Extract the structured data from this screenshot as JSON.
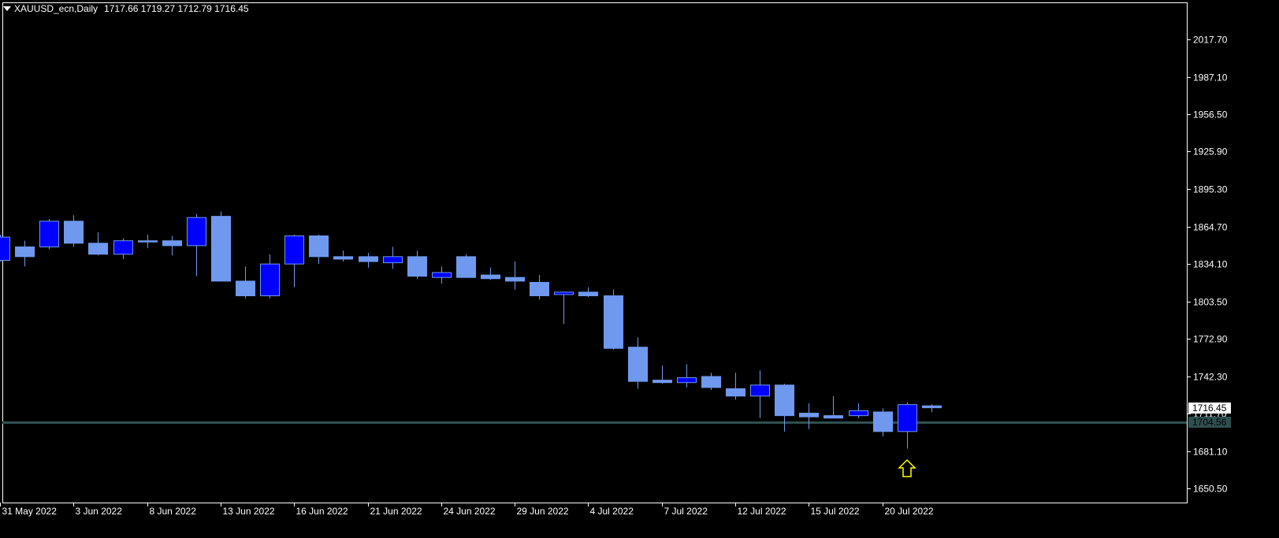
{
  "header": {
    "symbol": "XAUUSD_ecn,Daily",
    "ohlc": "1717.66 1719.27 1712.79 1716.45"
  },
  "colors": {
    "background": "#000000",
    "frame": "#ffffff",
    "bull_body": "#6f99ef",
    "bear_body": "#0000ff",
    "wick": "#6f99ef",
    "hline": "#2f4f4f",
    "arrow": "#ffff00",
    "text": "#ffffff"
  },
  "chart_data": {
    "type": "candlestick",
    "symbol": "XAUUSD_ecn",
    "timeframe": "Daily",
    "ylim": [
      1636,
      2036
    ],
    "y_ticks": [
      "2017.70",
      "1987.10",
      "1956.50",
      "1925.90",
      "1895.30",
      "1864.70",
      "1834.10",
      "1803.50",
      "1772.90",
      "1742.30",
      "1711.70",
      "1681.10",
      "1650.50"
    ],
    "x_ticks": [
      "31 May 2022",
      "3 Jun 2022",
      "8 Jun 2022",
      "13 Jun 2022",
      "16 Jun 2022",
      "21 Jun 2022",
      "24 Jun 2022",
      "29 Jun 2022",
      "4 Jul 2022",
      "7 Jul 2022",
      "12 Jul 2022",
      "15 Jul 2022",
      "20 Jul 2022"
    ],
    "current_price": "1716.45",
    "hline_price": "1704.56",
    "candles": [
      {
        "o": 1837.0,
        "h": 1858.0,
        "l": 1836.0,
        "c": 1856.0
      },
      {
        "o": 1848.0,
        "h": 1853.0,
        "l": 1832.0,
        "c": 1840.0
      },
      {
        "o": 1848.0,
        "h": 1871.0,
        "l": 1846.0,
        "c": 1869.0
      },
      {
        "o": 1869.0,
        "h": 1874.0,
        "l": 1848.0,
        "c": 1851.0
      },
      {
        "o": 1851.0,
        "h": 1860.0,
        "l": 1841.0,
        "c": 1842.0
      },
      {
        "o": 1842.0,
        "h": 1855.0,
        "l": 1838.0,
        "c": 1853.0
      },
      {
        "o": 1853.0,
        "h": 1858.0,
        "l": 1847.0,
        "c": 1852.0
      },
      {
        "o": 1853.0,
        "h": 1857.0,
        "l": 1841.0,
        "c": 1849.0
      },
      {
        "o": 1849.0,
        "h": 1875.0,
        "l": 1824.0,
        "c": 1872.0
      },
      {
        "o": 1873.0,
        "h": 1877.0,
        "l": 1820.0,
        "c": 1820.0
      },
      {
        "o": 1820.0,
        "h": 1832.0,
        "l": 1806.0,
        "c": 1808.0
      },
      {
        "o": 1808.0,
        "h": 1842.0,
        "l": 1806.0,
        "c": 1834.0
      },
      {
        "o": 1834.0,
        "h": 1858.0,
        "l": 1815.0,
        "c": 1857.0
      },
      {
        "o": 1857.0,
        "h": 1858.0,
        "l": 1834.0,
        "c": 1840.0
      },
      {
        "o": 1840.0,
        "h": 1845.0,
        "l": 1836.0,
        "c": 1838.0
      },
      {
        "o": 1840.0,
        "h": 1843.0,
        "l": 1831.0,
        "c": 1836.0
      },
      {
        "o": 1835.0,
        "h": 1848.0,
        "l": 1830.0,
        "c": 1840.0
      },
      {
        "o": 1840.0,
        "h": 1845.0,
        "l": 1822.0,
        "c": 1824.0
      },
      {
        "o": 1823.0,
        "h": 1832.0,
        "l": 1818.0,
        "c": 1827.0
      },
      {
        "o": 1840.0,
        "h": 1842.0,
        "l": 1823.0,
        "c": 1823.0
      },
      {
        "o": 1825.0,
        "h": 1831.0,
        "l": 1821.0,
        "c": 1822.0
      },
      {
        "o": 1823.0,
        "h": 1836.0,
        "l": 1813.0,
        "c": 1820.0
      },
      {
        "o": 1819.0,
        "h": 1825.0,
        "l": 1805.0,
        "c": 1808.0
      },
      {
        "o": 1809.0,
        "h": 1811.0,
        "l": 1785.0,
        "c": 1811.0
      },
      {
        "o": 1811.0,
        "h": 1815.0,
        "l": 1807.0,
        "c": 1808.0
      },
      {
        "o": 1808.0,
        "h": 1813.0,
        "l": 1764.0,
        "c": 1765.0
      },
      {
        "o": 1766.0,
        "h": 1774.0,
        "l": 1732.0,
        "c": 1738.0
      },
      {
        "o": 1739.0,
        "h": 1751.0,
        "l": 1736.0,
        "c": 1737.0
      },
      {
        "o": 1737.0,
        "h": 1752.0,
        "l": 1733.0,
        "c": 1741.0
      },
      {
        "o": 1742.0,
        "h": 1745.0,
        "l": 1731.0,
        "c": 1733.0
      },
      {
        "o": 1732.0,
        "h": 1745.0,
        "l": 1723.0,
        "c": 1726.0
      },
      {
        "o": 1726.0,
        "h": 1747.0,
        "l": 1708.0,
        "c": 1735.0
      },
      {
        "o": 1735.0,
        "h": 1736.0,
        "l": 1697.0,
        "c": 1710.0
      },
      {
        "o": 1712.0,
        "h": 1720.0,
        "l": 1699.0,
        "c": 1709.0
      },
      {
        "o": 1710.0,
        "h": 1726.0,
        "l": 1708.0,
        "c": 1708.0
      },
      {
        "o": 1710.0,
        "h": 1720.0,
        "l": 1708.0,
        "c": 1714.0
      },
      {
        "o": 1713.0,
        "h": 1716.0,
        "l": 1693.0,
        "c": 1697.0
      },
      {
        "o": 1697.0,
        "h": 1721.0,
        "l": 1683.0,
        "c": 1719.0
      },
      {
        "o": 1718.0,
        "h": 1719.3,
        "l": 1712.8,
        "c": 1716.45
      }
    ]
  }
}
